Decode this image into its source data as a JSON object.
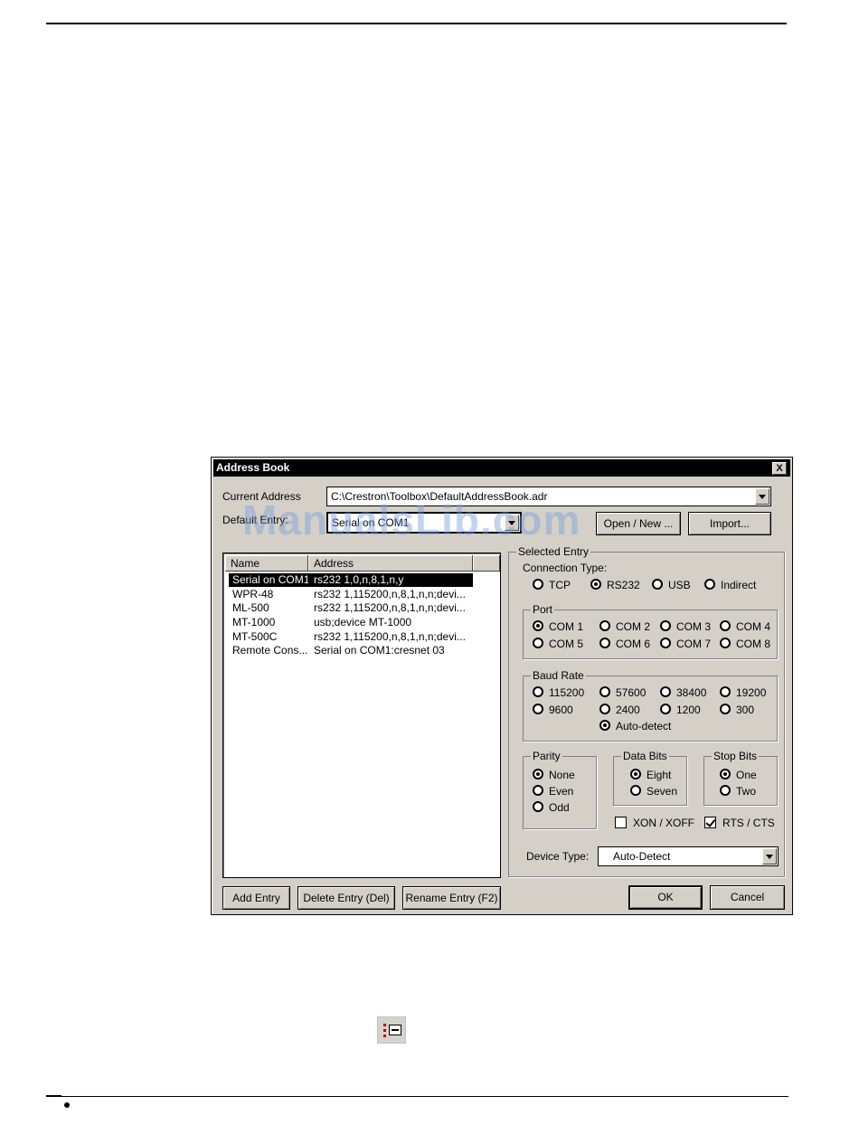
{
  "watermark": "ManualsLib.com",
  "dialog": {
    "title": "Address Book",
    "close_label": "X",
    "current_address_label": "Current Address",
    "current_address_value": "C:\\Crestron\\Toolbox\\DefaultAddressBook.adr",
    "default_entry_label": "Default Entry:",
    "default_entry_value": "Serial on COM1",
    "open_new_label": "Open / New ...",
    "import_label": "Import...",
    "list": {
      "columns": [
        "Name",
        "Address"
      ],
      "rows": [
        {
          "name": "Serial on COM1",
          "address": "rs232 1,0,n,8,1,n,y",
          "selected": true
        },
        {
          "name": "WPR-48",
          "address": "rs232 1,115200,n,8,1,n,n;devi..."
        },
        {
          "name": "ML-500",
          "address": "rs232 1,115200,n,8,1,n,n;devi..."
        },
        {
          "name": "MT-1000",
          "address": "usb;device MT-1000"
        },
        {
          "name": "MT-500C",
          "address": "rs232 1,115200,n,8,1,n,n;devi..."
        },
        {
          "name": "Remote Cons...",
          "address": "Serial on COM1:cresnet 03"
        }
      ]
    },
    "selected_entry": {
      "title": "Selected Entry",
      "connection_type_label": "Connection Type:",
      "connection_types": [
        "TCP",
        "RS232",
        "USB",
        "Indirect"
      ],
      "connection_selected": "RS232",
      "port_title": "Port",
      "ports": [
        "COM 1",
        "COM 2",
        "COM 3",
        "COM 4",
        "COM 5",
        "COM 6",
        "COM 7",
        "COM 8"
      ],
      "port_selected": "COM 1",
      "baud_title": "Baud Rate",
      "bauds": [
        "115200",
        "57600",
        "38400",
        "19200",
        "9600",
        "2400",
        "1200",
        "300",
        "Auto-detect"
      ],
      "baud_selected": "Auto-detect",
      "parity_title": "Parity",
      "parity": [
        "None",
        "Even",
        "Odd"
      ],
      "parity_selected": "None",
      "databits_title": "Data Bits",
      "databits": [
        "Eight",
        "Seven"
      ],
      "databits_selected": "Eight",
      "stopbits_title": "Stop Bits",
      "stopbits": [
        "One",
        "Two"
      ],
      "stopbits_selected": "One",
      "xon_label": "XON / XOFF",
      "xon_checked": false,
      "rts_label": "RTS / CTS",
      "rts_checked": true,
      "device_type_label": "Device Type:",
      "device_type_value": "Auto-Detect"
    },
    "add_entry_label": "Add Entry",
    "delete_entry_label": "Delete Entry (Del)",
    "rename_entry_label": "Rename Entry (F2)",
    "ok_label": "OK",
    "cancel_label": "Cancel"
  }
}
